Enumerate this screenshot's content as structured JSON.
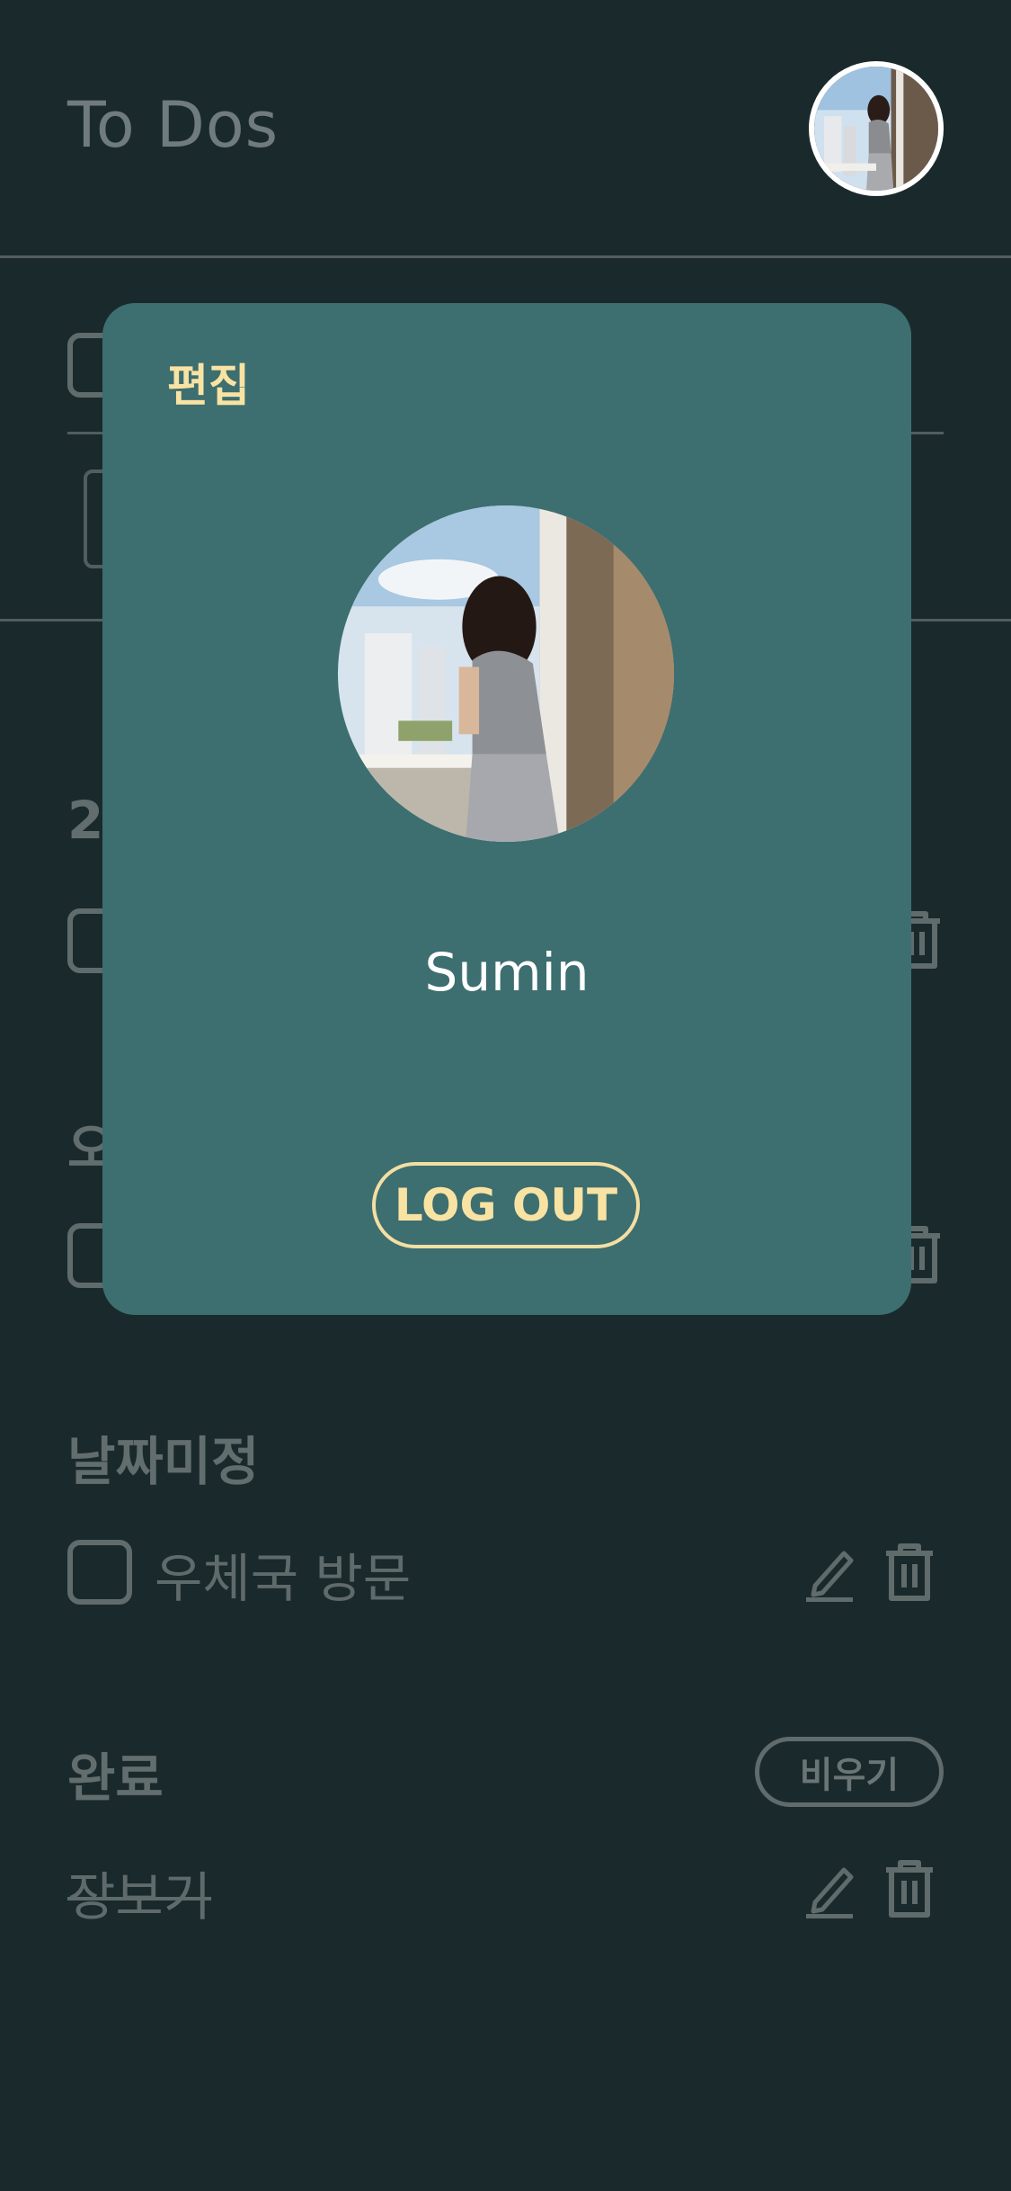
{
  "header": {
    "title": "To Dos"
  },
  "sections": {
    "partial_top": "2",
    "partial_mid": "오",
    "undated": {
      "heading": "날짜미정",
      "items": [
        {
          "text": "우체국 방문"
        }
      ]
    },
    "done": {
      "heading": "완료",
      "clear_label": "비우기",
      "items": [
        {
          "text": "장보기"
        }
      ]
    }
  },
  "modal": {
    "edit_label": "편집",
    "user_name": "Sumin",
    "logout_label": "LOG OUT"
  },
  "icons": {
    "edit": "pencil-icon",
    "delete": "trash-icon",
    "avatar": "avatar-photo"
  },
  "colors": {
    "background": "#1a2a2c",
    "modal": "#3d6e70",
    "accent": "#f9e3a3",
    "muted": "#606b6c"
  }
}
